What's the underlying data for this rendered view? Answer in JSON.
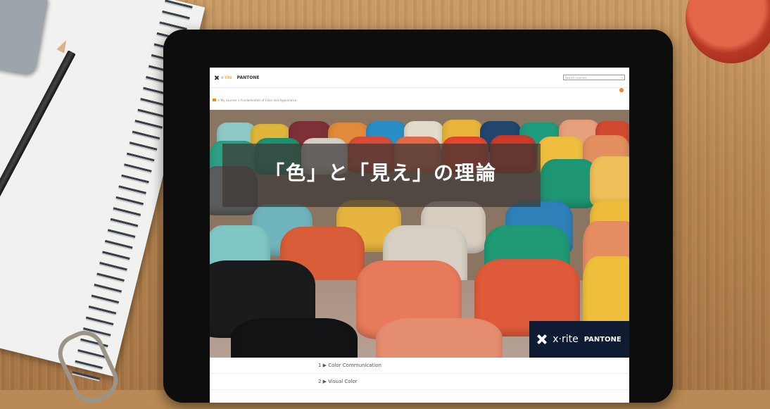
{
  "header": {
    "brand_small": "x·rite",
    "brand_pantone": "PANTONE",
    "search_placeholder": "Search courses"
  },
  "breadcrumb": {
    "text": "> My courses > Fundamentals of Color and Appearance"
  },
  "hero": {
    "title": "「色」と「見え」の理論",
    "brand_xrite": "x·rite",
    "brand_pantone": "PANTONE"
  },
  "courses": [
    {
      "label": "1 ▶ Color Communication"
    },
    {
      "label": "2 ▶ Visual Color"
    }
  ],
  "colors": {
    "brand_orange": "#e98a1b",
    "brand_navy": "#0f1b33",
    "bezel": "#0d0d0d"
  }
}
